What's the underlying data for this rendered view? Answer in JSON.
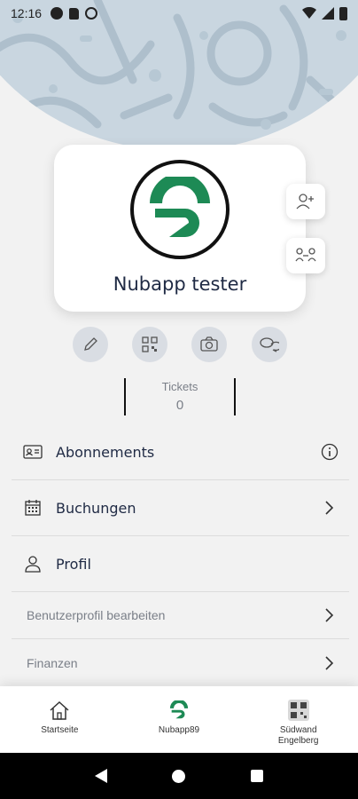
{
  "status_bar": {
    "time": "12:16"
  },
  "profile": {
    "name": "Nubapp tester"
  },
  "tickets": {
    "label": "Tickets",
    "count": "0"
  },
  "menu": {
    "subscriptions": "Abonnements",
    "bookings": "Buchungen",
    "profile": "Profil",
    "edit_profile": "Benutzerprofil bearbeiten",
    "finances": "Finanzen"
  },
  "bottom_nav": {
    "home": "Startseite",
    "nubapp": "Nubapp89",
    "gym": "Südwand\nEngelberg"
  },
  "colors": {
    "brand_green": "#1d8a55",
    "text_dark": "#1f2a44",
    "muted": "#7a7f88",
    "action_bg": "#d9dde3"
  }
}
